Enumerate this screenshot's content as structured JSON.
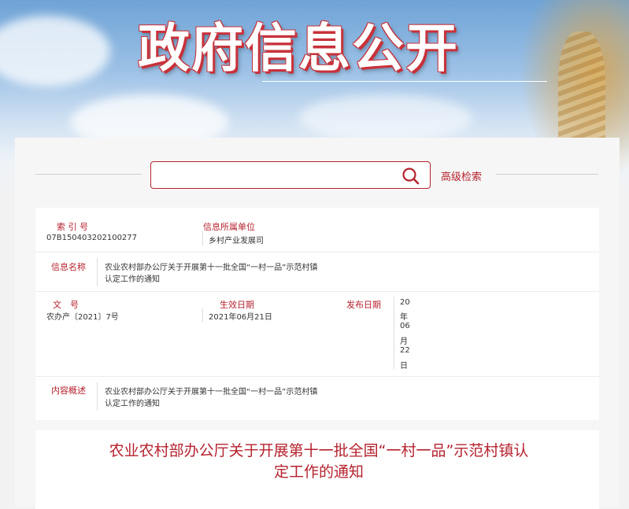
{
  "banner": {
    "title": "政府信息公开"
  },
  "search": {
    "placeholder": "",
    "advanced_label": "高级检索"
  },
  "info": {
    "index_label": "索 引 号",
    "index_value": "07B150403202100277",
    "unit_label": "信息所属单位",
    "unit_value": "乡村产业发展司",
    "name_label": "信息名称",
    "name_value_line1": "农业农村部办公厅关于开展第十一批全国“一村一品”示范村镇",
    "name_value_line2": "认定工作的通知",
    "doc_label": "文　号",
    "doc_value": "农办产〔2021〕7号",
    "effective_label": "生效日期",
    "effective_value": "2021年06月21日",
    "publish_label": "发布日期",
    "publish_value_chars": [
      "20",
      "年",
      "06",
      "月",
      "22",
      "日"
    ],
    "summary_label": "内容概述",
    "summary_line1": "农业农村部办公厅关于开展第十一批全国“一村一品”示范村镇",
    "summary_line2": "认定工作的通知"
  },
  "article": {
    "title_line1": "农业农村部办公厅关于开展第十一批全国“一村一品”示范村镇认",
    "title_line2": "定工作的通知"
  },
  "colors": {
    "accent": "#b5222e"
  },
  "icons": {
    "search": "search-icon"
  }
}
